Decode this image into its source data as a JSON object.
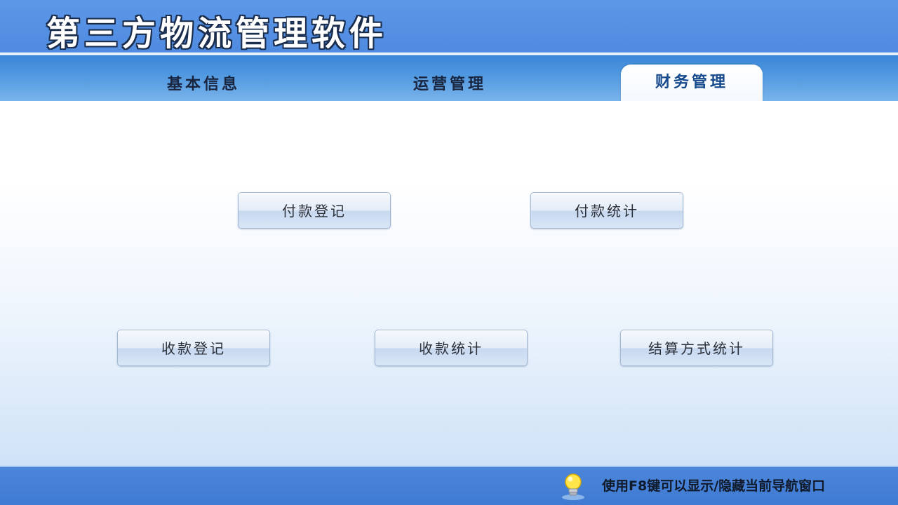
{
  "app": {
    "title": "第三方物流管理软件"
  },
  "tabs": [
    {
      "label": "基本信息",
      "active": false
    },
    {
      "label": "运营管理",
      "active": false
    },
    {
      "label": "财务管理",
      "active": true
    }
  ],
  "finance_buttons": [
    {
      "label": "付款登记"
    },
    {
      "label": "付款统计"
    },
    {
      "label": "收款登记"
    },
    {
      "label": "收款统计"
    },
    {
      "label": "结算方式统计"
    }
  ],
  "footer": {
    "hint_text": "使用F8键可以显示/隐藏当前导航窗口",
    "icon": "lightbulb-icon"
  },
  "colors": {
    "title_bar": "#4f8be0",
    "tab_bar": "#4e97e0",
    "footer": "#3f7bd2",
    "active_tab_text": "#164a8c"
  }
}
